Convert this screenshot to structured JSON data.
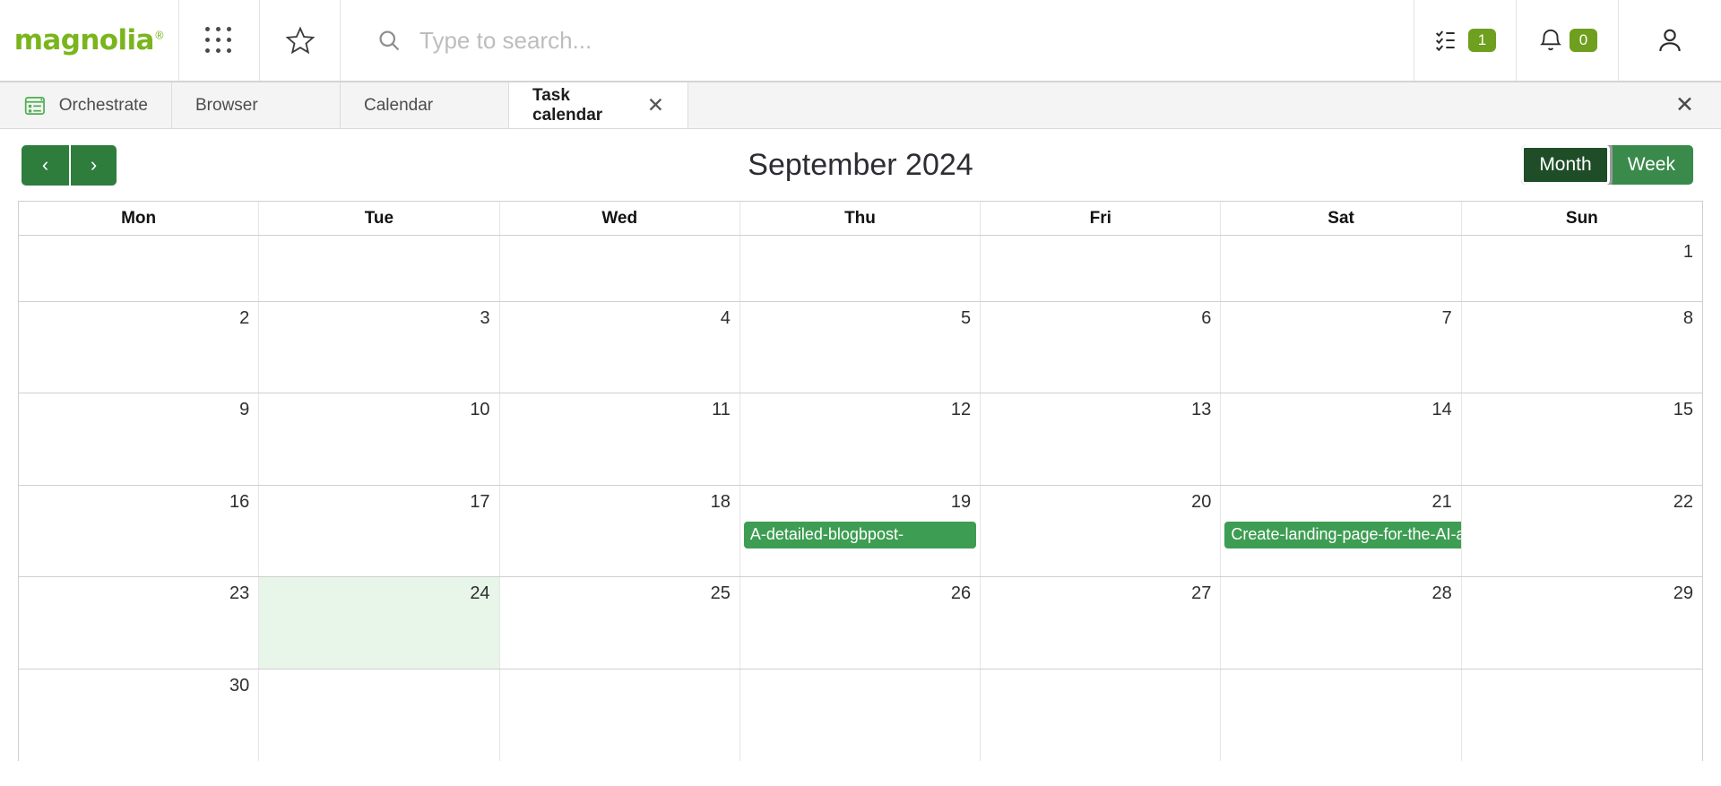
{
  "topbar": {
    "logo": "magnolia",
    "logo_registered": "®",
    "apps_icon": "app-grid-icon",
    "favorites_icon": "star-icon",
    "search": {
      "icon": "search-icon",
      "value": "",
      "placeholder": "Type to search..."
    },
    "tasks": {
      "icon": "tasks-checklist-icon",
      "count": "1"
    },
    "notifications": {
      "icon": "bell-icon",
      "count": "0"
    },
    "user": {
      "icon": "user-avatar-icon"
    }
  },
  "tabs": {
    "items": [
      {
        "label": "Orchestrate",
        "icon": "orchestrate-icon",
        "active": false,
        "closable": false
      },
      {
        "label": "Browser",
        "icon": "",
        "active": false,
        "closable": false
      },
      {
        "label": "Calendar",
        "icon": "",
        "active": false,
        "closable": false
      },
      {
        "label": "Task calendar",
        "icon": "",
        "active": true,
        "closable": true
      }
    ],
    "tab_close_glyph": "✕",
    "bar_close_glyph": "✕"
  },
  "toolbar": {
    "prev_label": "‹",
    "next_label": "›",
    "title": "September 2024",
    "views": [
      {
        "label": "Month",
        "active": true
      },
      {
        "label": "Week",
        "active": false
      }
    ]
  },
  "calendar": {
    "weekdays": [
      "Mon",
      "Tue",
      "Wed",
      "Thu",
      "Fri",
      "Sat",
      "Sun"
    ],
    "weeks": [
      [
        {
          "num": ""
        },
        {
          "num": ""
        },
        {
          "num": ""
        },
        {
          "num": ""
        },
        {
          "num": ""
        },
        {
          "num": ""
        },
        {
          "num": "1"
        }
      ],
      [
        {
          "num": "2"
        },
        {
          "num": "3"
        },
        {
          "num": "4"
        },
        {
          "num": "5"
        },
        {
          "num": "6"
        },
        {
          "num": "7"
        },
        {
          "num": "8"
        }
      ],
      [
        {
          "num": "9"
        },
        {
          "num": "10"
        },
        {
          "num": "11"
        },
        {
          "num": "12"
        },
        {
          "num": "13"
        },
        {
          "num": "14"
        },
        {
          "num": "15"
        }
      ],
      [
        {
          "num": "16"
        },
        {
          "num": "17"
        },
        {
          "num": "18"
        },
        {
          "num": "19",
          "event": "A-detailed-blogbpost-"
        },
        {
          "num": "20"
        },
        {
          "num": "21",
          "event": "Create-landing-page-for-the-AI-ad",
          "overflow": true
        },
        {
          "num": "22"
        }
      ],
      [
        {
          "num": "23"
        },
        {
          "num": "24",
          "today": true
        },
        {
          "num": "25"
        },
        {
          "num": "26"
        },
        {
          "num": "27"
        },
        {
          "num": "28"
        },
        {
          "num": "29"
        }
      ],
      [
        {
          "num": "30"
        },
        {
          "num": ""
        },
        {
          "num": ""
        },
        {
          "num": ""
        },
        {
          "num": ""
        },
        {
          "num": ""
        },
        {
          "num": ""
        }
      ]
    ]
  },
  "colors": {
    "brand_green": "#7ab51d",
    "badge_green": "#6f9f1e",
    "nav_green": "#2e7d3d",
    "view_green": "#3a8a4c",
    "view_active_green": "#1f4d28",
    "event_green": "#3d9d52",
    "today_bg": "#e8f5e9"
  }
}
